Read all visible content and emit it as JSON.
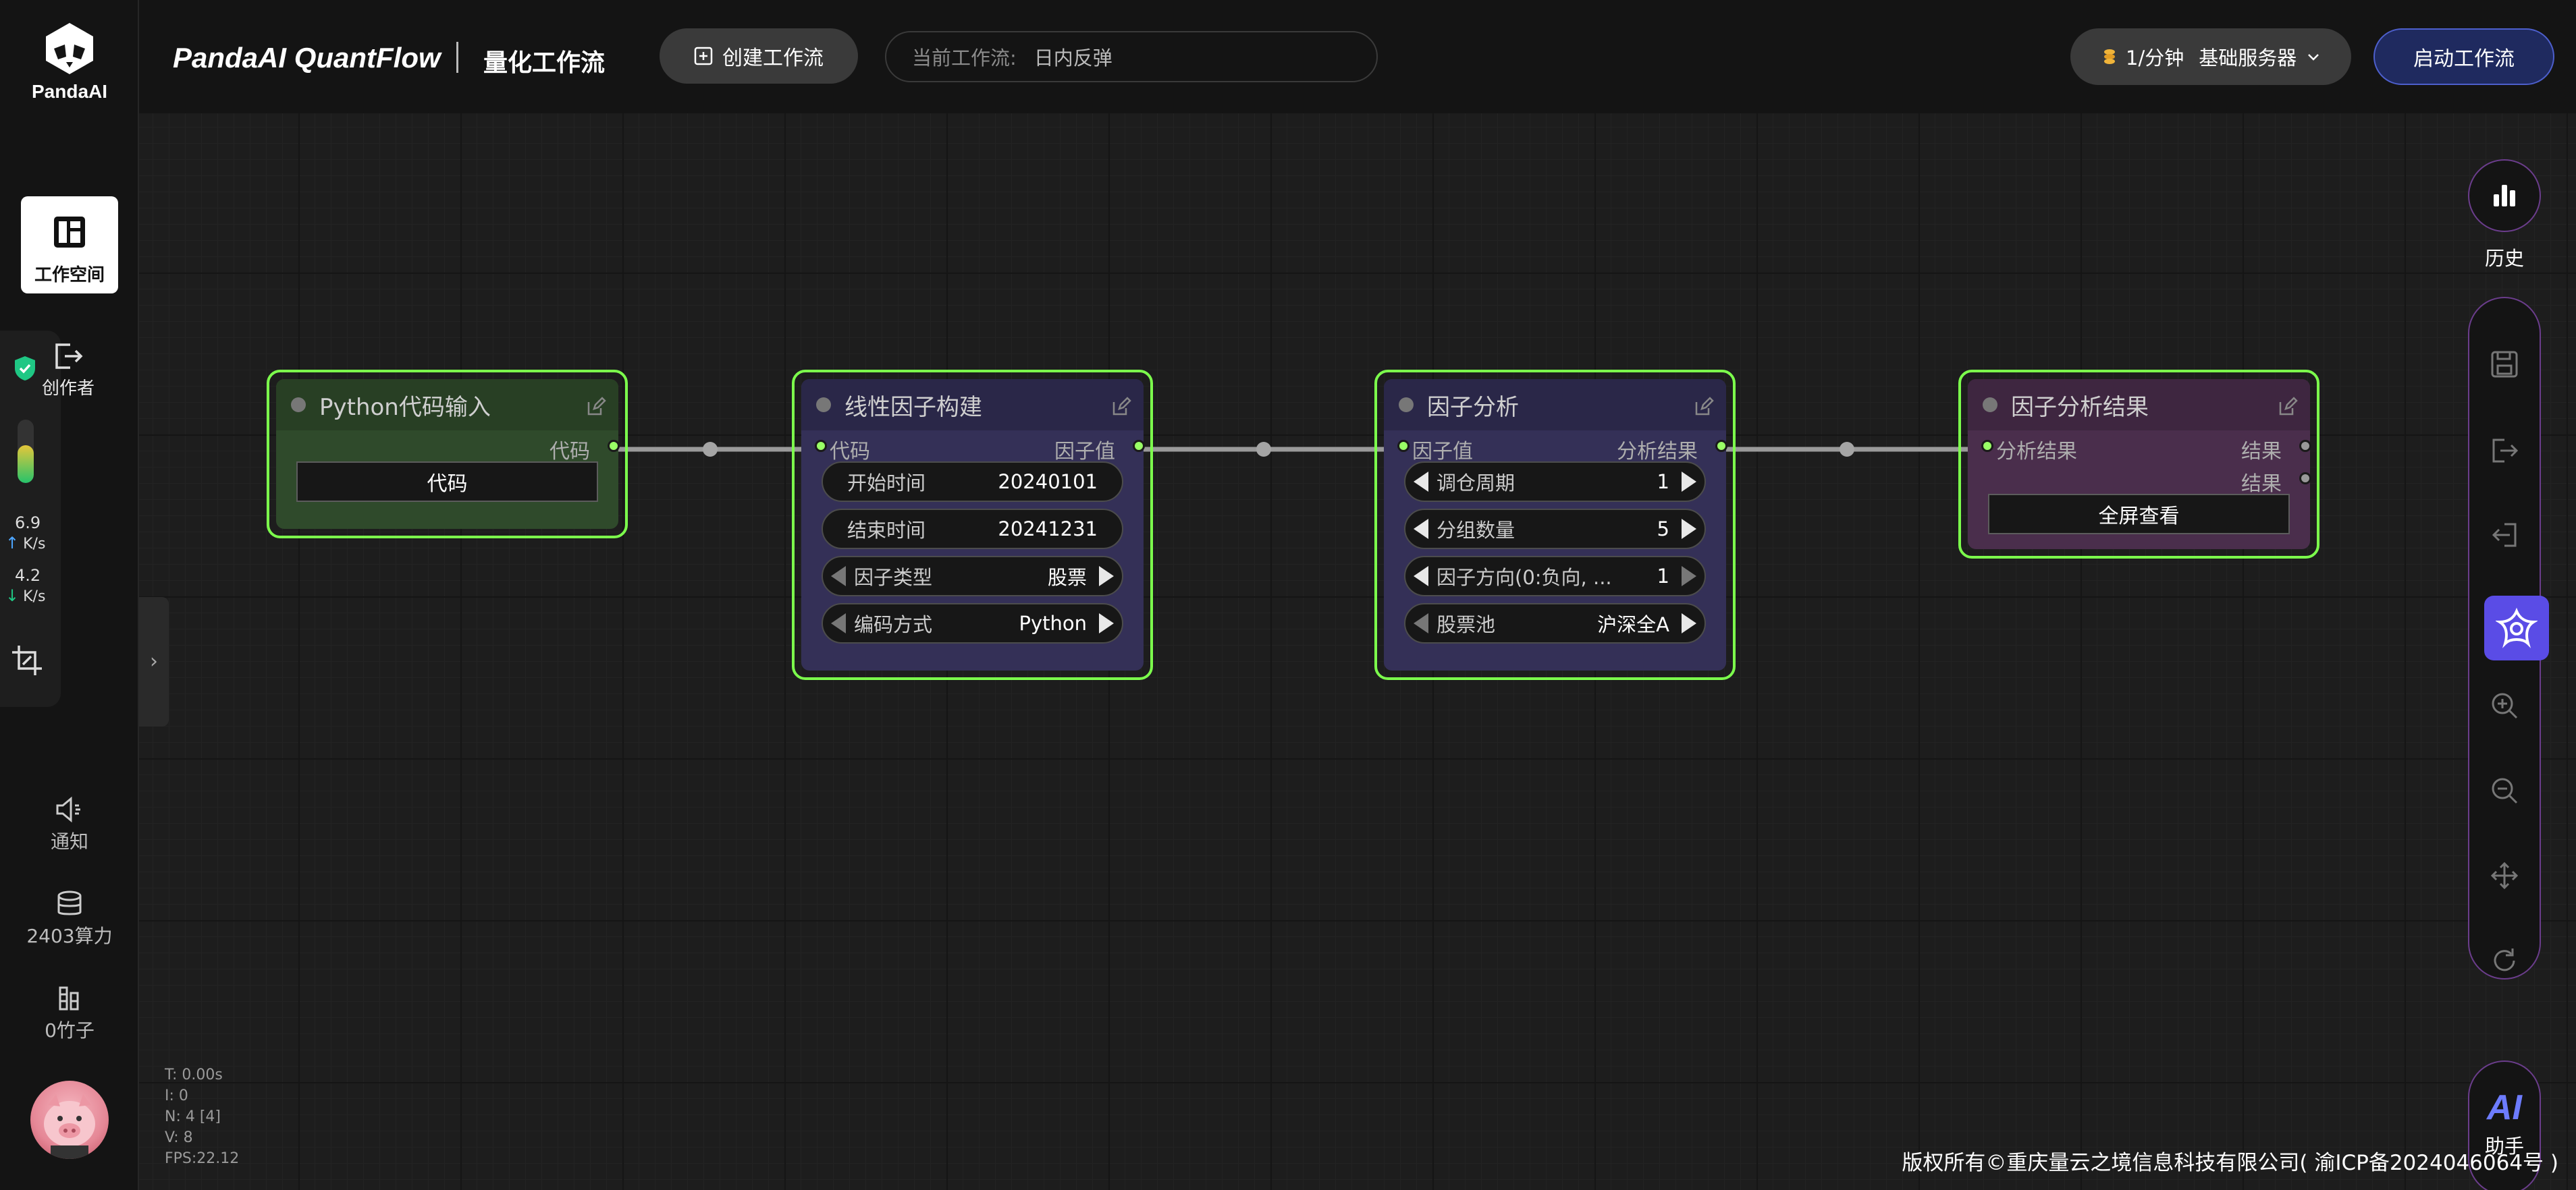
{
  "sidebar": {
    "logo_text": "PandaAI",
    "workspace_label": "工作空间",
    "creator_label": "创作者",
    "gauge_level": 0.6,
    "upload_speed": "6.9",
    "download_speed": "4.2",
    "speed_unit": "K/s",
    "notify_label": "通知",
    "compute_label": "2403算力",
    "bamboo_label": "0竹子",
    "collapse_glyph": "›"
  },
  "header": {
    "brand": "PandaAI QuantFlow",
    "subtitle": "量化工作流",
    "create_label": "创建工作流",
    "current_label": "当前工作流:",
    "current_value": "日内反弹",
    "rate_label": "1/分钟",
    "server_label": "基础服务器",
    "start_label": "启动工作流"
  },
  "nodes": {
    "python_input": {
      "title": "Python代码输入",
      "output": "代码",
      "button": "代码"
    },
    "linear_factor": {
      "title": "线性因子构建",
      "input": "代码",
      "output": "因子值",
      "widgets": [
        {
          "name": "开始时间",
          "value": "20240101"
        },
        {
          "name": "结束时间",
          "value": "20241231"
        },
        {
          "name": "因子类型",
          "value": "股票"
        },
        {
          "name": "编码方式",
          "value": "Python"
        }
      ]
    },
    "factor_analysis": {
      "title": "因子分析",
      "input": "因子值",
      "output": "分析结果",
      "widgets": [
        {
          "name": "调仓周期",
          "value": "1"
        },
        {
          "name": "分组数量",
          "value": "5"
        },
        {
          "name": "因子方向(0:负向, ...",
          "value": "1"
        },
        {
          "name": "股票池",
          "value": "沪深全A"
        }
      ]
    },
    "factor_result": {
      "title": "因子分析结果",
      "input": "分析结果",
      "output1": "结果",
      "output2": "结果",
      "button": "全屏查看"
    }
  },
  "toolbar": {
    "history_label": "历史",
    "ai_text": "AI",
    "assistant_label": "助手"
  },
  "debug": {
    "t": "T: 0.00s",
    "i": "I: 0",
    "n": "N: 4 [4]",
    "v": "V: 8",
    "fps": "FPS:22.12"
  },
  "footer": "版权所有©重庆量云之境信息科技有限公司( 渝ICP备2024046064号 )",
  "colors": {
    "node_border": "#7cff4c",
    "accent": "#5a4ce6",
    "start_btn": "#1f2a5f"
  }
}
